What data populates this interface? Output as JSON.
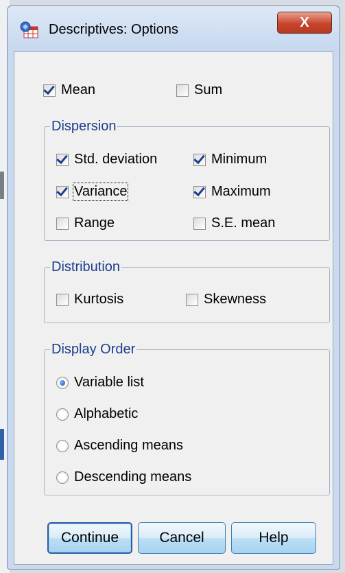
{
  "window": {
    "title": "Descriptives: Options",
    "close_glyph": "X"
  },
  "mean": {
    "label": "Mean",
    "mnemonic_index": 0,
    "checked": true
  },
  "sum": {
    "label": "Sum",
    "checked": false
  },
  "dispersion": {
    "title": "Dispersion",
    "items": [
      {
        "label": "Std. deviation",
        "checked": true
      },
      {
        "label": "Minimum",
        "checked": true
      },
      {
        "label": "Variance",
        "checked": true,
        "focused": true
      },
      {
        "label": "Maximum",
        "checked": true
      },
      {
        "label": "Range",
        "checked": false
      },
      {
        "label": "S.E. mean",
        "checked": false
      }
    ]
  },
  "distribution": {
    "title": "Distribution",
    "items": [
      {
        "label": "Kurtosis",
        "checked": false
      },
      {
        "label": "Skewness",
        "checked": false
      }
    ]
  },
  "display_order": {
    "title": "Display Order",
    "selected": "Variable list",
    "options": [
      {
        "label": "Variable list"
      },
      {
        "label": "Alphabetic"
      },
      {
        "label": "Ascending means"
      },
      {
        "label": "Descending means"
      }
    ]
  },
  "buttons": {
    "continue": "Continue",
    "cancel": "Cancel",
    "help": "Help"
  },
  "colors": {
    "group_title": "#1b3c8c",
    "check": "#1d3e8c",
    "close": "#c8452c"
  }
}
